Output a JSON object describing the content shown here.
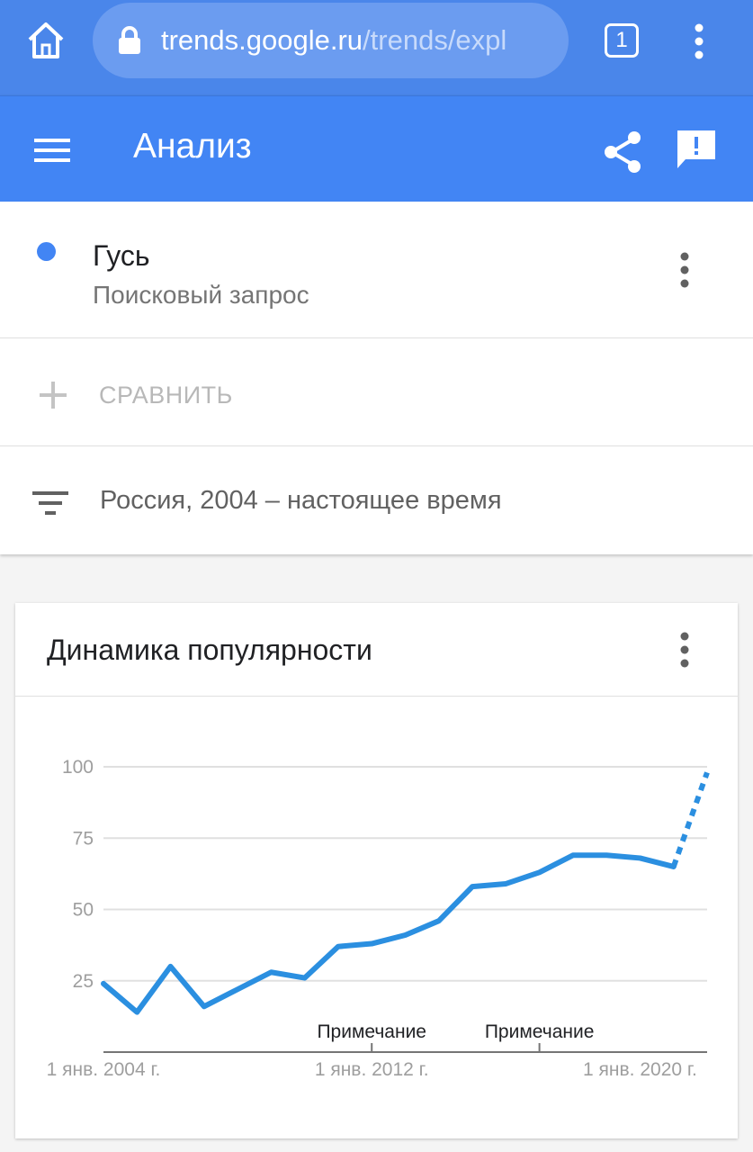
{
  "browser": {
    "url_host": "trends.google.ru",
    "url_path": "/trends/expl",
    "tab_count": "1"
  },
  "app_bar": {
    "title": "Анализ"
  },
  "search_term": {
    "name": "Гусь",
    "type": "Поисковый запрос",
    "color": "#4285f4"
  },
  "compare": {
    "label": "СРАВНИТЬ"
  },
  "filter": {
    "label": "Россия, 2004 – настоящее время"
  },
  "icons": [
    "home-icon",
    "lock-icon",
    "more-vert-icon",
    "menu-icon",
    "share-icon",
    "feedback-icon",
    "add-icon",
    "filter-icon"
  ],
  "card": {
    "title": "Динамика популярности"
  },
  "chart_data": {
    "type": "line",
    "ylim": [
      0,
      100
    ],
    "grid": true,
    "y_ticks": [
      100,
      75,
      50,
      25
    ],
    "x_tick_labels": [
      {
        "label": "1 янв. 2004 г.",
        "year": 2004
      },
      {
        "label": "1 янв. 2012 г.",
        "year": 2012
      },
      {
        "label": "1 янв. 2020 г.",
        "year": 2020
      }
    ],
    "annotations": [
      {
        "label": "Примечание",
        "year": 2012
      },
      {
        "label": "Примечание",
        "year": 2017
      }
    ],
    "line_color": "#2b8fe0",
    "x": [
      2004,
      2005,
      2006,
      2007,
      2008,
      2009,
      2010,
      2011,
      2012,
      2013,
      2014,
      2015,
      2016,
      2017,
      2018,
      2019,
      2020,
      2021
    ],
    "values": [
      24,
      14,
      30,
      16,
      22,
      28,
      26,
      37,
      38,
      41,
      46,
      58,
      59,
      63,
      69,
      69,
      68,
      65
    ],
    "partial": {
      "x": [
        2021,
        2022
      ],
      "values": [
        65,
        98
      ]
    }
  }
}
